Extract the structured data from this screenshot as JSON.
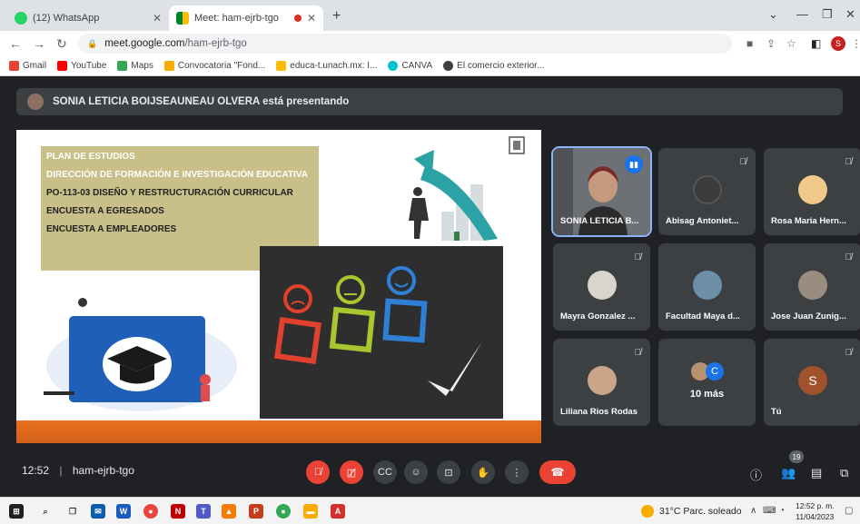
{
  "browser": {
    "tabs": [
      {
        "title": "(12) WhatsApp",
        "active": false,
        "icon": "whatsapp-icon"
      },
      {
        "title": "Meet: ham-ejrb-tgo",
        "active": true,
        "icon": "meet-icon"
      }
    ],
    "url_host": "meet.google.com",
    "url_path": "/ham-ejrb-tgo",
    "profile_initial": "S",
    "bookmarks": [
      "Gmail",
      "YouTube",
      "Maps",
      "Convocatoria \"Fond...",
      "educa-t.unach.mx: I...",
      "CANVA",
      "El comercio exterior..."
    ]
  },
  "meet": {
    "presenter_text": "SONIA LETICIA BOIJSEAUNEAU OLVERA está presentando",
    "slide": {
      "lines": [
        "PLAN DE ESTUDIOS",
        "DIRECCIÓN DE FORMACIÓN E INVESTIGACIÓN EDUCATIVA",
        "PO-113-03 DISEÑO Y RESTRUCTURACIÓN CURRICULAR",
        "ENCUESTA A EGRESADOS",
        "ENCUESTA A EMPLEADORES"
      ]
    },
    "participants": [
      {
        "name": "SONIA LETICIA B...",
        "speaking": true
      },
      {
        "name": "Abisag Antoniet...",
        "muted": true
      },
      {
        "name": "Rosa Maria Hern...",
        "muted": true
      },
      {
        "name": "Mayra Gonzalez ...",
        "muted": true
      },
      {
        "name": "Facultad Maya d...",
        "muted": true
      },
      {
        "name": "Jose Juan Zunig...",
        "muted": true
      },
      {
        "name": "Liliana Rios Rodas",
        "muted": true
      },
      {
        "name": "10 más",
        "avatar_letter": "C"
      },
      {
        "name": "Tú",
        "avatar_letter": "S",
        "muted": true
      }
    ],
    "time": "12:52",
    "separator": "|",
    "meeting_code": "ham-ejrb-tgo",
    "people_count": "19"
  },
  "taskbar": {
    "weather": "31°C  Parc. soleado",
    "clock_time": "12:52 p. m.",
    "clock_date": "11/04/2023"
  },
  "colors": {
    "meet_bg": "#202124",
    "tile_bg": "#3c4043",
    "red": "#ea4335",
    "slide_box": "#c9bf88",
    "slide_footer": "#e86f1f"
  }
}
